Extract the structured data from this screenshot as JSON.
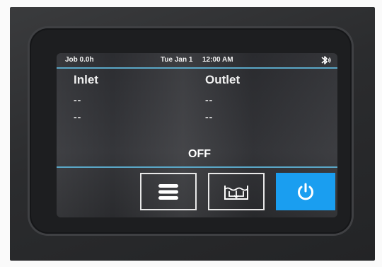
{
  "status_bar": {
    "job": "Job 0.0h",
    "date": "Tue Jan 1",
    "time": "12:00 AM",
    "bluetooth_icon": "bluetooth-icon"
  },
  "inlet": {
    "label": "Inlet",
    "value1": "--",
    "value2": "--"
  },
  "outlet": {
    "label": "Outlet",
    "value1": "--",
    "value2": "--"
  },
  "state": "OFF",
  "buttons": {
    "menu_icon": "menu-icon",
    "tank_icon": "tank-icon",
    "power_icon": "power-icon"
  },
  "colors": {
    "accent": "#5aa7c7",
    "power_button": "#1a9ef0"
  }
}
